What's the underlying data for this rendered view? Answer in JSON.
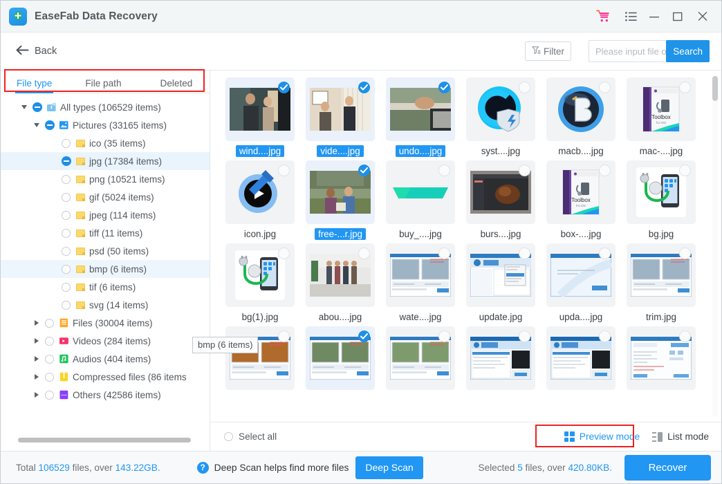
{
  "window": {
    "title": "EaseFab Data Recovery",
    "logo_icon": "plus-badge-icon",
    "controls": [
      {
        "name": "cart-icon",
        "label": "Cart"
      },
      {
        "name": "menu-list-icon",
        "label": "Menu"
      },
      {
        "name": "minimize-icon",
        "label": "Minimize"
      },
      {
        "name": "maximize-icon",
        "label": "Maximize"
      },
      {
        "name": "close-icon",
        "label": "Close"
      }
    ]
  },
  "toolbar": {
    "back_label": "Back",
    "back_icon": "arrow-left-icon",
    "filter_label": "Filter",
    "filter_icon": "funnel-icon",
    "search_placeholder": "Please input file or fol...",
    "search_value": "",
    "search_button": "Search"
  },
  "sidebar": {
    "tabs": [
      {
        "label": "File type",
        "active": true
      },
      {
        "label": "File path",
        "active": false
      },
      {
        "label": "Deleted",
        "active": false
      }
    ],
    "highlight_color": "#ee2222",
    "tooltip": "bmp (6 items)",
    "tree": [
      {
        "label": "All types (106529 items)",
        "depth": 0,
        "arrow": "down",
        "check": "partial",
        "icon": "drive-icon",
        "icon_color": "#7ec3f0",
        "state": "normal"
      },
      {
        "label": "Pictures (33165 items)",
        "depth": 1,
        "arrow": "down",
        "check": "partial",
        "icon": "picture-icon",
        "icon_color": "#2196f3",
        "state": "normal"
      },
      {
        "label": "ico (35 items)",
        "depth": 2,
        "arrow": "none",
        "check": "empty",
        "icon": "folder-icon",
        "icon_color": "#fcd96b",
        "state": "normal"
      },
      {
        "label": "jpg (17384 items)",
        "depth": 2,
        "arrow": "none",
        "check": "partial",
        "icon": "folder-icon",
        "icon_color": "#fcd96b",
        "state": "selected"
      },
      {
        "label": "png (10521 items)",
        "depth": 2,
        "arrow": "none",
        "check": "empty",
        "icon": "folder-icon",
        "icon_color": "#fcd96b",
        "state": "normal"
      },
      {
        "label": "gif (5024 items)",
        "depth": 2,
        "arrow": "none",
        "check": "empty",
        "icon": "folder-icon",
        "icon_color": "#fcd96b",
        "state": "normal"
      },
      {
        "label": "jpeg (114 items)",
        "depth": 2,
        "arrow": "none",
        "check": "empty",
        "icon": "folder-icon",
        "icon_color": "#fcd96b",
        "state": "normal"
      },
      {
        "label": "tiff (11 items)",
        "depth": 2,
        "arrow": "none",
        "check": "empty",
        "icon": "folder-icon",
        "icon_color": "#fcd96b",
        "state": "normal"
      },
      {
        "label": "psd (50 items)",
        "depth": 2,
        "arrow": "none",
        "check": "empty",
        "icon": "folder-icon",
        "icon_color": "#fcd96b",
        "state": "normal"
      },
      {
        "label": "bmp (6 items)",
        "depth": 2,
        "arrow": "none",
        "check": "empty",
        "icon": "folder-icon",
        "icon_color": "#fcd96b",
        "state": "hover"
      },
      {
        "label": "tif (6 items)",
        "depth": 2,
        "arrow": "none",
        "check": "empty",
        "icon": "folder-icon",
        "icon_color": "#fcd96b",
        "state": "normal"
      },
      {
        "label": "svg (14 items)",
        "depth": 2,
        "arrow": "none",
        "check": "empty",
        "icon": "folder-icon",
        "icon_color": "#fcd96b",
        "state": "normal"
      },
      {
        "label": "Files (30004 items)",
        "depth": 1,
        "arrow": "right",
        "check": "empty",
        "icon": "document-icon",
        "icon_color": "#ffa726",
        "state": "normal"
      },
      {
        "label": "Videos (284 items)",
        "depth": 1,
        "arrow": "right",
        "check": "empty",
        "icon": "video-icon",
        "icon_color": "#f5336b",
        "state": "normal"
      },
      {
        "label": "Audios (404 items)",
        "depth": 1,
        "arrow": "right",
        "check": "empty",
        "icon": "audio-icon",
        "icon_color": "#1fc45d",
        "state": "normal"
      },
      {
        "label": "Compressed files (86 items",
        "depth": 1,
        "arrow": "right",
        "check": "empty",
        "icon": "archive-icon",
        "icon_color": "#ffd21f",
        "state": "normal"
      },
      {
        "label": "Others (42586 items)",
        "depth": 1,
        "arrow": "right",
        "check": "empty",
        "icon": "others-icon",
        "icon_color": "#8a3ffc",
        "state": "normal"
      }
    ]
  },
  "files": [
    {
      "name": "wind....jpg",
      "selected": true,
      "thumb": "photo-two-people-hallway"
    },
    {
      "name": "vide....jpg",
      "selected": true,
      "thumb": "photo-two-men-room"
    },
    {
      "name": "undo....jpg",
      "selected": true,
      "thumb": "photo-hands-railing"
    },
    {
      "name": "syst....jpg",
      "selected": false,
      "thumb": "logo-c-shield"
    },
    {
      "name": "macb....jpg",
      "selected": false,
      "thumb": "logo-b-circle"
    },
    {
      "name": "mac-....jpg",
      "selected": false,
      "thumb": "box-toolbox-ios"
    },
    {
      "name": "icon.jpg",
      "selected": false,
      "thumb": "logo-play-hammer"
    },
    {
      "name": "free-...r.jpg",
      "selected": true,
      "thumb": "photo-students-campus"
    },
    {
      "name": "buy_....jpg",
      "selected": false,
      "thumb": "banner-teal-gradient"
    },
    {
      "name": "burs....jpg",
      "selected": false,
      "thumb": "photo-chocolate-screen"
    },
    {
      "name": "box-....jpg",
      "selected": false,
      "thumb": "box-toolbox-purple"
    },
    {
      "name": "bg.jpg",
      "selected": false,
      "thumb": "phone-stethoscope"
    },
    {
      "name": "bg(1).jpg",
      "selected": false,
      "thumb": "phone-stethoscope"
    },
    {
      "name": "abou....jpg",
      "selected": false,
      "thumb": "photo-team-office"
    },
    {
      "name": "wate....jpg",
      "selected": false,
      "thumb": "screenshot-editor-beach"
    },
    {
      "name": "update.jpg",
      "selected": false,
      "thumb": "screenshot-menu-dialog"
    },
    {
      "name": "upda....jpg",
      "selected": false,
      "thumb": "screenshot-blue-dialog"
    },
    {
      "name": "trim.jpg",
      "selected": false,
      "thumb": "screenshot-editor-yellow"
    },
    {
      "name": "",
      "selected": false,
      "thumb": "screenshot-editor-orange"
    },
    {
      "name": "",
      "selected": true,
      "thumb": "screenshot-editor-street"
    },
    {
      "name": "",
      "selected": false,
      "thumb": "screenshot-editor-people"
    },
    {
      "name": "",
      "selected": false,
      "thumb": "screenshot-app-dark"
    },
    {
      "name": "",
      "selected": false,
      "thumb": "screenshot-app-blue"
    },
    {
      "name": "",
      "selected": false,
      "thumb": "screenshot-form-blue"
    }
  ],
  "modebar": {
    "select_all_label": "Select all",
    "select_all_checked": false,
    "preview_mode_label": "Preview mode",
    "list_mode_label": "List mode",
    "active_mode": "Preview mode",
    "highlight_color": "#ee2222"
  },
  "status": {
    "total_prefix": "Total ",
    "total_count": "106529",
    "total_mid": " files, over ",
    "total_size": "143.22GB.",
    "help_icon": "question-mark-icon",
    "deep_scan_hint": "Deep Scan helps find more files",
    "deep_scan_button": "Deep Scan",
    "selected_prefix": "Selected ",
    "selected_count": "5",
    "selected_mid": " files, over ",
    "selected_size": "420.80KB.",
    "recover_button": "Recover",
    "accent_color": "#2196f3"
  }
}
